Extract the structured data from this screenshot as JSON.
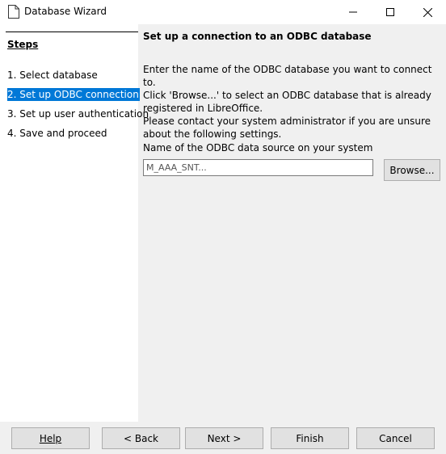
{
  "window": {
    "title": "Database Wizard",
    "icon": "document-icon"
  },
  "steps": {
    "title": "Steps",
    "items": [
      {
        "label": "1. Select database",
        "active": false
      },
      {
        "label": "2. Set up ODBC connection",
        "active": true
      },
      {
        "label": "3. Set up user authentication",
        "active": false
      },
      {
        "label": "4. Save and proceed",
        "active": false
      }
    ]
  },
  "main": {
    "title": "Set up a connection to an ODBC database",
    "description_lines": [
      "Enter the name of the ODBC database you want to connect to.",
      "Click 'Browse...' to select an ODBC database that is already registered in LibreOffice.",
      "Please contact your system administrator if you are unsure about the following settings."
    ],
    "dsn_label": "Name of the ODBC data source on your system",
    "dsn_value": "M_AAA_SNT...",
    "browse_label": "Browse..."
  },
  "buttons": {
    "help": "Help",
    "back": "< Back",
    "next": "Next >",
    "finish": "Finish",
    "cancel": "Cancel"
  },
  "colors": {
    "selection": "#0078d7",
    "panel": "#ffffff",
    "background": "#f0f0f0"
  }
}
